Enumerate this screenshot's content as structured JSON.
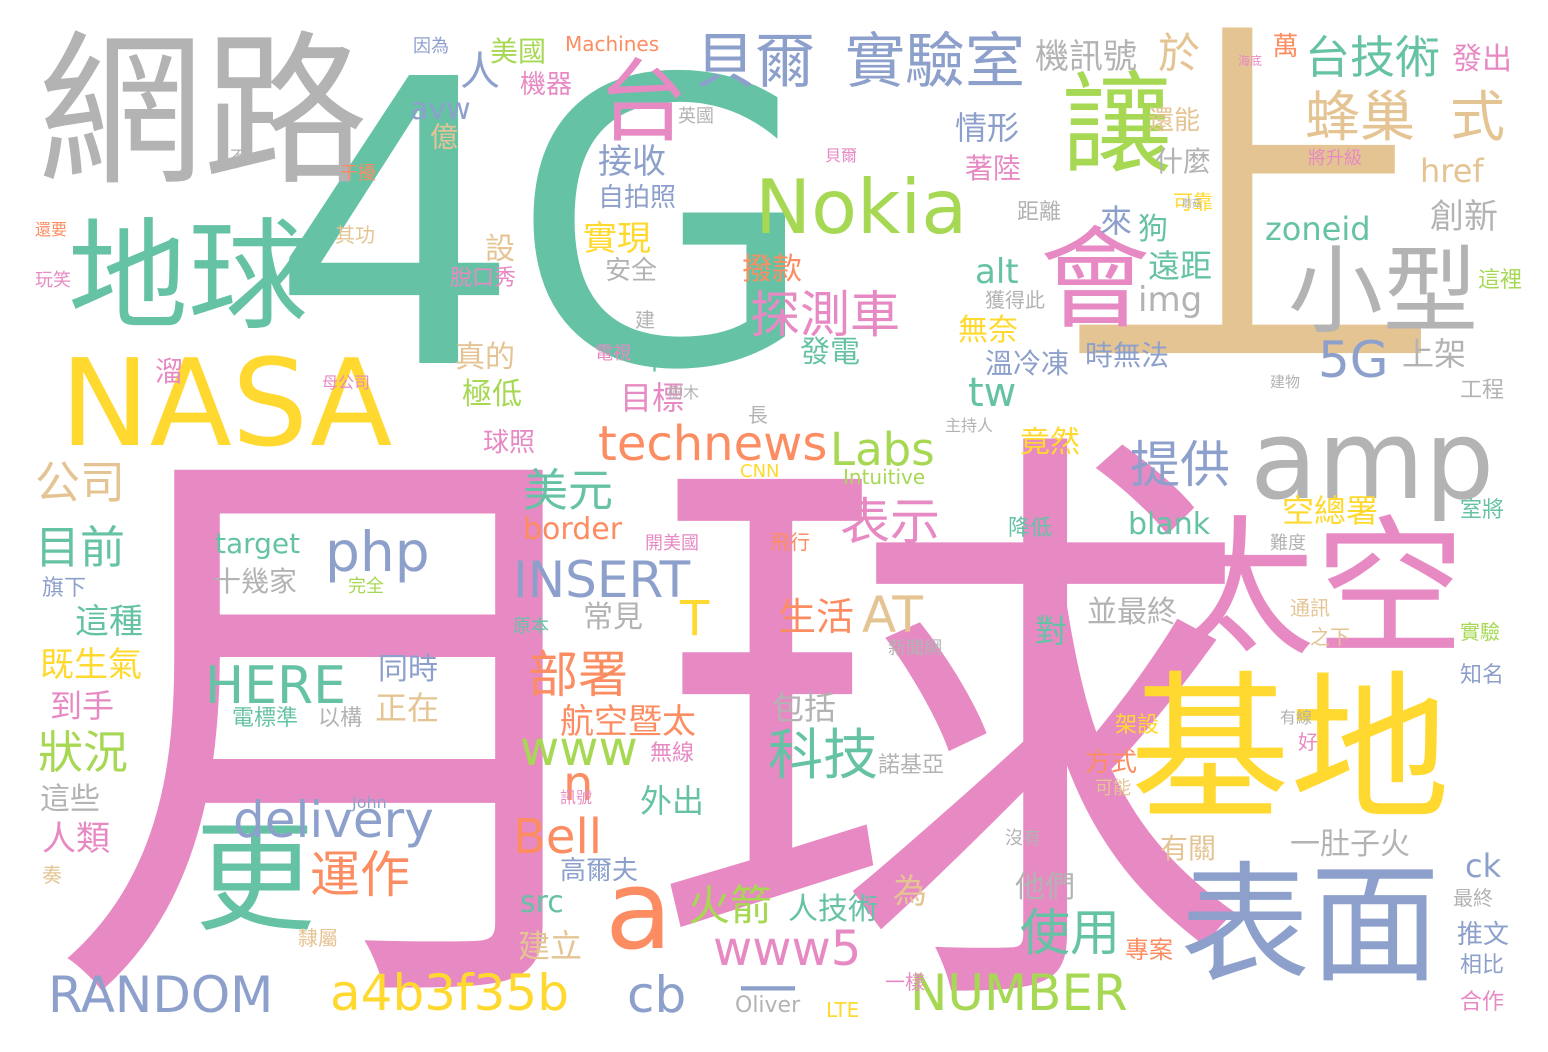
{
  "palette": {
    "teal": "#66c2a5",
    "pink": "#e78ac3",
    "yellow": "#ffd92f",
    "tan": "#e5c494",
    "gray": "#b3b3b3",
    "blue": "#8da0cb",
    "orange": "#fc8d62",
    "green": "#a6d854"
  },
  "words": {
    "w4g": "4G",
    "moon": "月球",
    "shang": "上",
    "network": "網路",
    "nasa": "NASA",
    "earth": "地球",
    "rang": "讓",
    "hui": "會",
    "nokia": "Nokia",
    "amp": "amp",
    "taikong": "太空",
    "jidi": "基地",
    "biaomian": "表面",
    "geng": "更",
    "a": "a",
    "xiaoxing": "小型",
    "tai": "台",
    "beier": "貝爾",
    "shiyanshi": "實驗室",
    "fengchao": "蜂巢",
    "shi": "式",
    "taijishu": "台技術",
    "yu": "於",
    "tanceche": "探測車",
    "g5": "5G",
    "technews": "technews",
    "labs": "Labs",
    "tigong": "提供",
    "php": "php",
    "insert": "INSERT",
    "here": "HERE",
    "delivery": "delivery",
    "random": "RANDOM",
    "a4b": "a4b3f35b",
    "cb": "cb",
    "www5": "www5",
    "number": "NUMBER",
    "bell": "Bell",
    "www": "www",
    "n": "n",
    "keji": "科技",
    "bushu": "部署",
    "yunzuo": "運作",
    "shiyong": "使用",
    "huojian": "火箭",
    "biaoshi": "表示",
    "meiyuan": "美元",
    "gongsi": "公司",
    "muqian": "目前",
    "zhuangkuang": "狀況",
    "at": "AT",
    "t": "T",
    "dash": "—",
    "shenghuo": "生活",
    "hangkong": "航空暨太",
    "meiguo": "美國",
    "ren": "人",
    "jixunhao": "機訊號",
    "jiqi": "機器",
    "machines": "Machines",
    "yinwei": "因為",
    "fachu": "發出",
    "wan": "萬",
    "haicheng": "海底",
    "jieshou": "接收",
    "zipaizhao": "自拍照",
    "shixian": "實現",
    "anquan": "安全",
    "bokuan": "撥款",
    "fadian": "發電",
    "qingxing": "情形",
    "zhaolu": "著陸",
    "shenme": "什麼",
    "huanneng": "還能",
    "href": "href",
    "juli": "距離",
    "kekao": "可靠",
    "chuangxin": "創新",
    "zoneid": "zoneid",
    "lai": "來",
    "gou": "狗",
    "yuanju": "遠距",
    "img": "img",
    "alt": "alt",
    "huodeci": "獲得此",
    "wunai": "無奈",
    "wenleng": "溫冷凍",
    "shiwufa": "時無法",
    "shangjia": "上架",
    "zhelihe": "這裡",
    "jianwu": "建物",
    "gongcheng": "工程",
    "tw": "tw",
    "jingran": "竟然",
    "zhuchiren": "主持人",
    "kongzongshu": "空總署",
    "blank": "blank",
    "border": "border",
    "target": "target",
    "shijijia": "十幾家",
    "bingzuizhong": "並最終",
    "intuitive": "Intuitive",
    "cnn": "CNN",
    "qiuzhao": "球照",
    "zhende": "真的",
    "jidi2": "極低",
    "mubiao": "目標",
    "nian": "年",
    "zhezhong": "這種",
    "jishengqi": "既生氣",
    "daoshou": "到手",
    "zhexie": "這些",
    "renlei": "人類",
    "qixia": "旗下",
    "yi": "億",
    "avw": "avw",
    "kaixiao": "玩笑",
    "haiyao": "還要",
    "qigong": "其功",
    "tuokouxiu": "脫口秀",
    "jian": "建",
    "dianshi": "電視",
    "shumu": "樹木",
    "zhang": "長",
    "muqongsi": "母公司",
    "liu": "溜",
    "changjian": "常見",
    "tongshi": "同時",
    "zhengzai": "正在",
    "dianbiaozhun": "電標準",
    "yigou": "以構",
    "baokuo": "包括",
    "wuxian": "無線",
    "nuojiya": "諾基亞",
    "waichu": "外出",
    "fangshi": "方式",
    "jiashe": "架設",
    "youguan": "有關",
    "yidu": "一肚子火",
    "tamen": "他們",
    "gaoerfu": "高爾夫",
    "wei": "為",
    "renjishu": "人技術",
    "src": "src",
    "jianli": "建立",
    "zhuanan": "專案",
    "yiyang": "一樣",
    "oliver": "Oliver",
    "lte": "LTE",
    "ck": "ck",
    "tuiwen": "推文",
    "xiangbi": "相比",
    "hezuo": "合作",
    "zuizhong": "最終",
    "tongxun": "通訊",
    "zhixia": "之下",
    "shiyan": "實驗",
    "zhiming": "知名",
    "nandu": "難度",
    "shijiang": "室將",
    "jiangdi": "降低",
    "feixing": "飛行",
    "kaimeiguo": "開美國",
    "dui": "對",
    "yuanben": "原本",
    "xinwenwang": "新聞網",
    "meiyou": "沒有",
    "john": "John",
    "kaneng": "可能",
    "xunhao": "訊號",
    "zou": "奏",
    "lishu": "隸屬",
    "jiangshengji": "將升級",
    "youxian": "有線",
    "hao": "好",
    "bu": "不",
    "she": "設",
    "yingguo": "英國",
    "ganrao": "干擾",
    "beier2": "貝爾",
    "wanquan": "完全",
    "yin": "因",
    "mogu": "蘑菇"
  }
}
